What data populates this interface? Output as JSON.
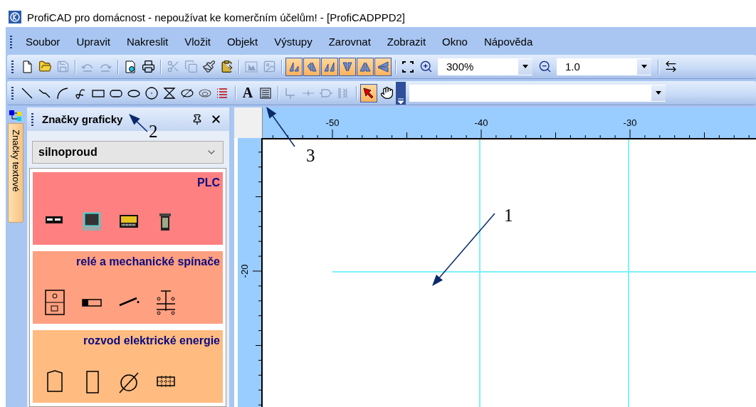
{
  "window": {
    "title": "ProfiCAD pro domácnost - nepoužívat ke komerčním účelům! - [ProfiCADPPD2]"
  },
  "menu": [
    "Soubor",
    "Upravit",
    "Nakreslit",
    "Vložit",
    "Objekt",
    "Výstupy",
    "Zarovnat",
    "Zobrazit",
    "Okno",
    "Nápověda"
  ],
  "toolbar_main": {
    "items": [
      {
        "kind": "new",
        "disabled": false,
        "selected": false
      },
      {
        "kind": "open",
        "disabled": false,
        "selected": false
      },
      {
        "kind": "save",
        "disabled": true,
        "selected": false
      },
      {
        "kind": "separator"
      },
      {
        "kind": "undo",
        "disabled": true,
        "selected": false
      },
      {
        "kind": "redo",
        "disabled": true,
        "selected": false
      },
      {
        "kind": "separator"
      },
      {
        "kind": "preview",
        "disabled": false,
        "selected": false
      },
      {
        "kind": "print",
        "disabled": false,
        "selected": false
      },
      {
        "kind": "separator"
      },
      {
        "kind": "cut",
        "disabled": true,
        "selected": false
      },
      {
        "kind": "copy",
        "disabled": true,
        "selected": false
      },
      {
        "kind": "brush",
        "disabled": false,
        "selected": false
      },
      {
        "kind": "paste",
        "disabled": false,
        "selected": false
      },
      {
        "kind": "separator"
      },
      {
        "kind": "photo",
        "disabled": true,
        "selected": false
      },
      {
        "kind": "image",
        "disabled": true,
        "selected": false
      },
      {
        "kind": "separator"
      },
      {
        "kind": "rotate-left",
        "disabled": false,
        "selected": true
      },
      {
        "kind": "flip-up",
        "disabled": false,
        "selected": true
      },
      {
        "kind": "rotate-right",
        "disabled": false,
        "selected": true
      },
      {
        "kind": "flip-down",
        "disabled": false,
        "selected": true
      },
      {
        "kind": "mirror",
        "disabled": false,
        "selected": true
      },
      {
        "kind": "mirror-left",
        "disabled": false,
        "selected": true
      },
      {
        "kind": "separator"
      },
      {
        "kind": "fit",
        "disabled": false,
        "selected": false
      },
      {
        "kind": "zoom-in",
        "disabled": false,
        "selected": false
      },
      {
        "kind": "combo",
        "value": "300%"
      },
      {
        "kind": "zoom-out",
        "disabled": false,
        "selected": false
      },
      {
        "kind": "combo",
        "value": "1.0"
      },
      {
        "kind": "separator"
      },
      {
        "kind": "swap",
        "disabled": false,
        "selected": false
      }
    ]
  },
  "toolbar_draw": {
    "items": [
      {
        "kind": "line",
        "disabled": false,
        "selected": false
      },
      {
        "kind": "polyline",
        "disabled": false,
        "selected": false
      },
      {
        "kind": "arc",
        "disabled": false,
        "selected": false
      },
      {
        "kind": "curve",
        "disabled": false,
        "selected": false
      },
      {
        "kind": "rectangle",
        "disabled": false,
        "selected": false
      },
      {
        "kind": "rounded",
        "disabled": false,
        "selected": false
      },
      {
        "kind": "ellipse",
        "disabled": false,
        "selected": false
      },
      {
        "kind": "circle",
        "disabled": false,
        "selected": false
      },
      {
        "kind": "hourglass",
        "disabled": false,
        "selected": false
      },
      {
        "kind": "crossed",
        "disabled": false,
        "selected": false
      },
      {
        "kind": "linked",
        "disabled": false,
        "selected": false
      },
      {
        "kind": "list",
        "disabled": false,
        "selected": false
      },
      {
        "kind": "separator"
      },
      {
        "kind": "text",
        "glyph": "A",
        "disabled": false,
        "selected": false
      },
      {
        "kind": "paragraph",
        "disabled": false,
        "selected": false
      },
      {
        "kind": "separator"
      },
      {
        "kind": "wire",
        "disabled": true,
        "selected": false
      },
      {
        "kind": "junction",
        "disabled": true,
        "selected": false
      },
      {
        "kind": "gate",
        "disabled": true,
        "selected": false
      },
      {
        "kind": "coil",
        "disabled": true,
        "selected": false
      },
      {
        "kind": "separator"
      },
      {
        "kind": "pointer",
        "disabled": false,
        "selected": true
      },
      {
        "kind": "hand",
        "disabled": false,
        "selected": false
      },
      {
        "kind": "overflow"
      },
      {
        "kind": "combo"
      }
    ]
  },
  "side_tab": {
    "label": "Značky textové"
  },
  "panel": {
    "title": "Značky graficky",
    "library": "silnoproud",
    "categories": [
      {
        "title": "PLC",
        "color": "#ff8080"
      },
      {
        "title": "relé a mechanické spínače",
        "color": "#ffa080"
      },
      {
        "title": "rozvod elektrické energie",
        "color": "#ffbb80"
      }
    ]
  },
  "canvas": {
    "x_ruler": [
      "-50",
      "-40",
      "-30"
    ],
    "y_ruler": [
      "-20"
    ]
  },
  "annotations": [
    {
      "label": "1"
    },
    {
      "label": "2"
    },
    {
      "label": "3"
    }
  ]
}
